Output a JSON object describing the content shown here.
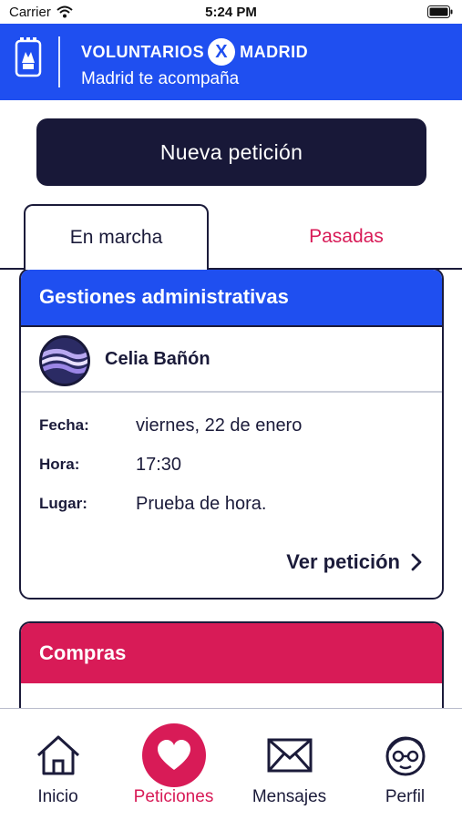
{
  "status_bar": {
    "carrier": "Carrier",
    "time": "5:24 PM"
  },
  "header": {
    "brand_left": "VOLUNTARIOS",
    "brand_x": "X",
    "brand_right": "MADRID",
    "tagline": "Madrid te acompaña"
  },
  "actions": {
    "new_request": "Nueva petición"
  },
  "tabs": {
    "active": "En marcha",
    "inactive": "Pasadas"
  },
  "request_card": {
    "category": "Gestiones administrativas",
    "person": "Celia Bañón",
    "fields": [
      {
        "label": "Fecha:",
        "value": "viernes, 22 de enero"
      },
      {
        "label": "Hora:",
        "value": "17:30"
      },
      {
        "label": "Lugar:",
        "value": "Prueba de hora."
      }
    ],
    "view_label": "Ver petición"
  },
  "second_card": {
    "category": "Compras"
  },
  "tabbar": {
    "items": [
      {
        "label": "Inicio",
        "icon": "house-icon"
      },
      {
        "label": "Peticiones",
        "icon": "heart-icon",
        "active": true
      },
      {
        "label": "Mensajes",
        "icon": "envelope-icon"
      },
      {
        "label": "Perfil",
        "icon": "face-glasses-icon"
      }
    ]
  },
  "colors": {
    "brand_blue": "#1f4ff0",
    "accent_pink": "#d81b57",
    "navy": "#181838"
  }
}
